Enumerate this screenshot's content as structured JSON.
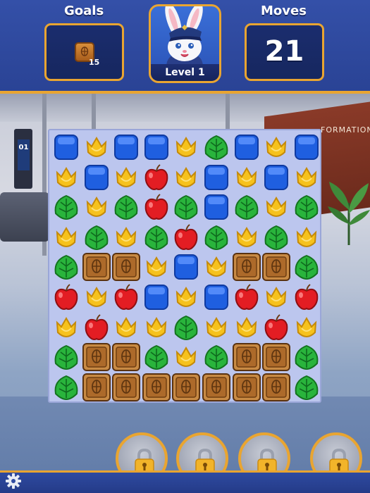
{
  "hud": {
    "goals_label": "Goals",
    "moves_label": "Moves",
    "goal_count": "15",
    "goal_icon": "wooden-crate-icon",
    "moves_value": "21",
    "level_label": "Level 1",
    "avatar": "bunny-pilot-avatar"
  },
  "scene": {
    "kiosk_label": "01",
    "sign_text": "FORMATION D"
  },
  "colors": {
    "hud_blue": "#2a4395",
    "accent_gold": "#e9a531",
    "board": "#bcc6ee"
  },
  "board": {
    "rows": [
      [
        "blue",
        "yellow",
        "blue",
        "blue",
        "yellow",
        "green",
        "blue",
        "yellow",
        "blue"
      ],
      [
        "yellow",
        "blue",
        "yellow",
        "red",
        "yellow",
        "blue",
        "yellow",
        "blue",
        "yellow"
      ],
      [
        "green",
        "yellow",
        "green",
        "red",
        "green",
        "blue",
        "green",
        "yellow",
        "green"
      ],
      [
        "yellow",
        "green",
        "yellow",
        "green",
        "red",
        "green",
        "yellow",
        "green",
        "yellow"
      ],
      [
        "green",
        "crate",
        "crate",
        "yellow",
        "blue",
        "yellow",
        "crate",
        "crate",
        "green"
      ],
      [
        "red",
        "yellow",
        "red",
        "blue",
        "yellow",
        "blue",
        "red",
        "yellow",
        "red"
      ],
      [
        "yellow",
        "red",
        "yellow",
        "yellow",
        "green",
        "yellow",
        "yellow",
        "red",
        "yellow"
      ],
      [
        "green",
        "crate",
        "crate",
        "green",
        "yellow",
        "green",
        "crate",
        "crate",
        "green"
      ],
      [
        "green",
        "crate",
        "crate",
        "crate",
        "crate",
        "crate",
        "crate",
        "crate",
        "green"
      ]
    ],
    "legend": {
      "blue": "blue-cube-icon",
      "yellow": "yellow-tulip-icon",
      "green": "green-leaf-icon",
      "red": "red-apple-icon",
      "crate": "wooden-crate-icon"
    }
  },
  "boosters": [
    {
      "icon": "padlock-icon",
      "state": "locked"
    },
    {
      "icon": "padlock-icon",
      "state": "locked"
    },
    {
      "icon": "padlock-icon",
      "state": "locked"
    },
    {
      "icon": "padlock-icon",
      "state": "locked"
    }
  ],
  "settings_icon": "gear-icon"
}
